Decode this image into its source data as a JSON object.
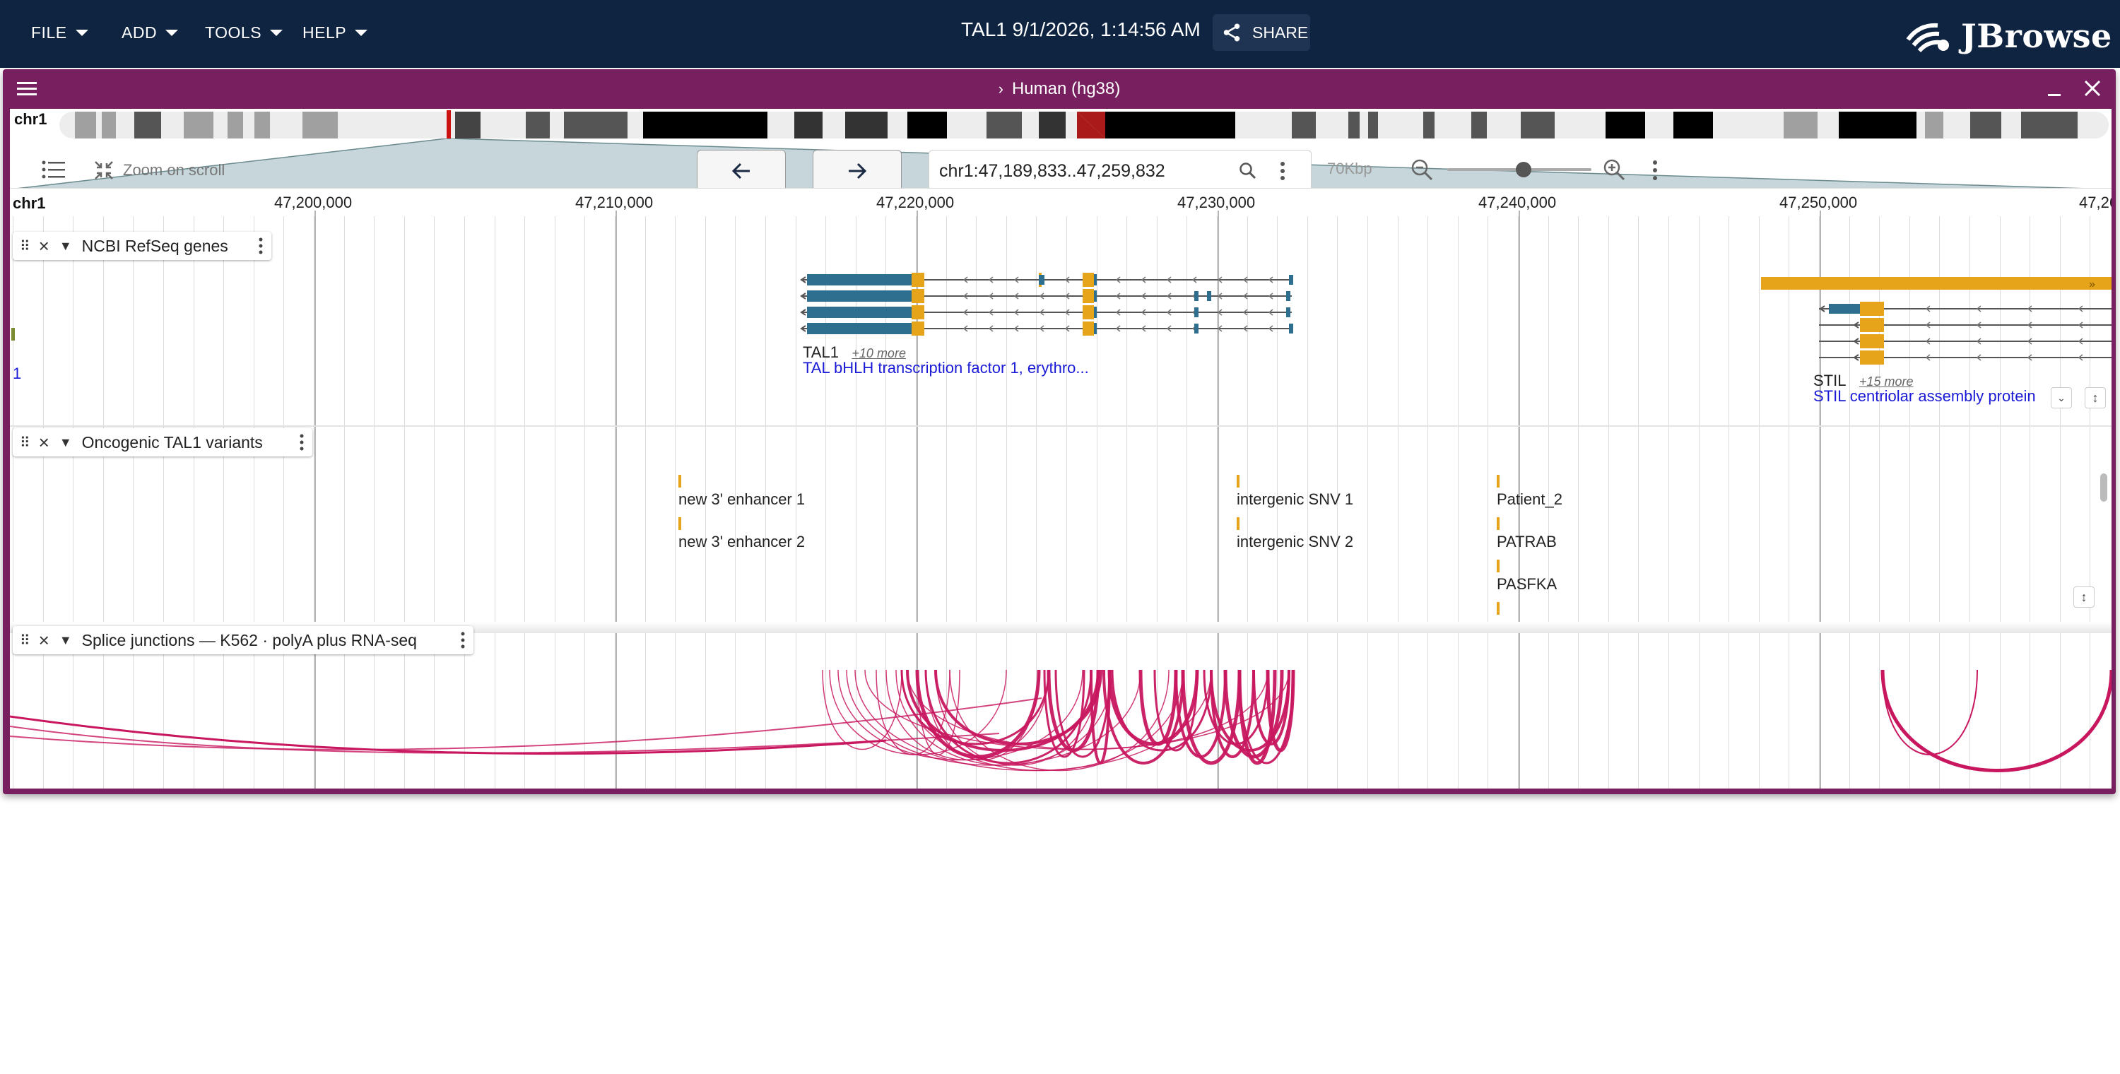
{
  "menu": {
    "file": "FILE",
    "add": "ADD",
    "tools": "TOOLS",
    "help": "HELP"
  },
  "session": {
    "title": "TAL1 9/1/2026, 1:14:56 AM",
    "share_label": "SHARE"
  },
  "logo": {
    "text": "JBrowse"
  },
  "view": {
    "assembly_title": "Human (hg38)",
    "chromosome": "chr1",
    "zoom_on_scroll_label": "Zoom on scroll",
    "locstring": "chr1:47,189,833..47,259,832",
    "scale_label": "70Kbp",
    "zoom_level": 0.53
  },
  "ruler": {
    "chrom": "chr1",
    "ticks": [
      "47,200,000",
      "47,210,000",
      "47,220,000",
      "47,230,000",
      "47,240,000",
      "47,250,000",
      "47,26"
    ]
  },
  "tracks": {
    "genes": {
      "name": "NCBI RefSeq genes",
      "tal1": {
        "name": "TAL1",
        "more": "+10 more",
        "desc": "TAL bHLH transcription factor 1, erythro..."
      },
      "stil": {
        "name": "STIL",
        "more": "+15 more",
        "desc": "STIL centriolar assembly protein"
      },
      "edge_label": "1"
    },
    "variants": {
      "name": "Oncogenic TAL1 variants",
      "items": [
        "new 3' enhancer 1",
        "new 3' enhancer 2",
        "intergenic SNV 1",
        "intergenic SNV 2",
        "Patient_2",
        "PATRAB",
        "PASFKA"
      ]
    },
    "splice": {
      "name": "Splice junctions — K562 · polyA plus RNA-seq"
    }
  },
  "colors": {
    "appbar": "#0e2441",
    "view_header": "#78205f",
    "utr": "#e5a41a",
    "cds": "#2e6e8e",
    "junction": "#c8175f"
  },
  "icons": [
    "chevron-down-icon",
    "share-icon",
    "hamburger-icon",
    "minimize-icon",
    "close-icon",
    "track-selector-icon",
    "zoom-on-scroll-icon",
    "arrow-left-icon",
    "arrow-right-icon",
    "search-icon",
    "more-vert-icon",
    "zoom-out-icon",
    "zoom-in-icon",
    "drag-handle-icon"
  ]
}
